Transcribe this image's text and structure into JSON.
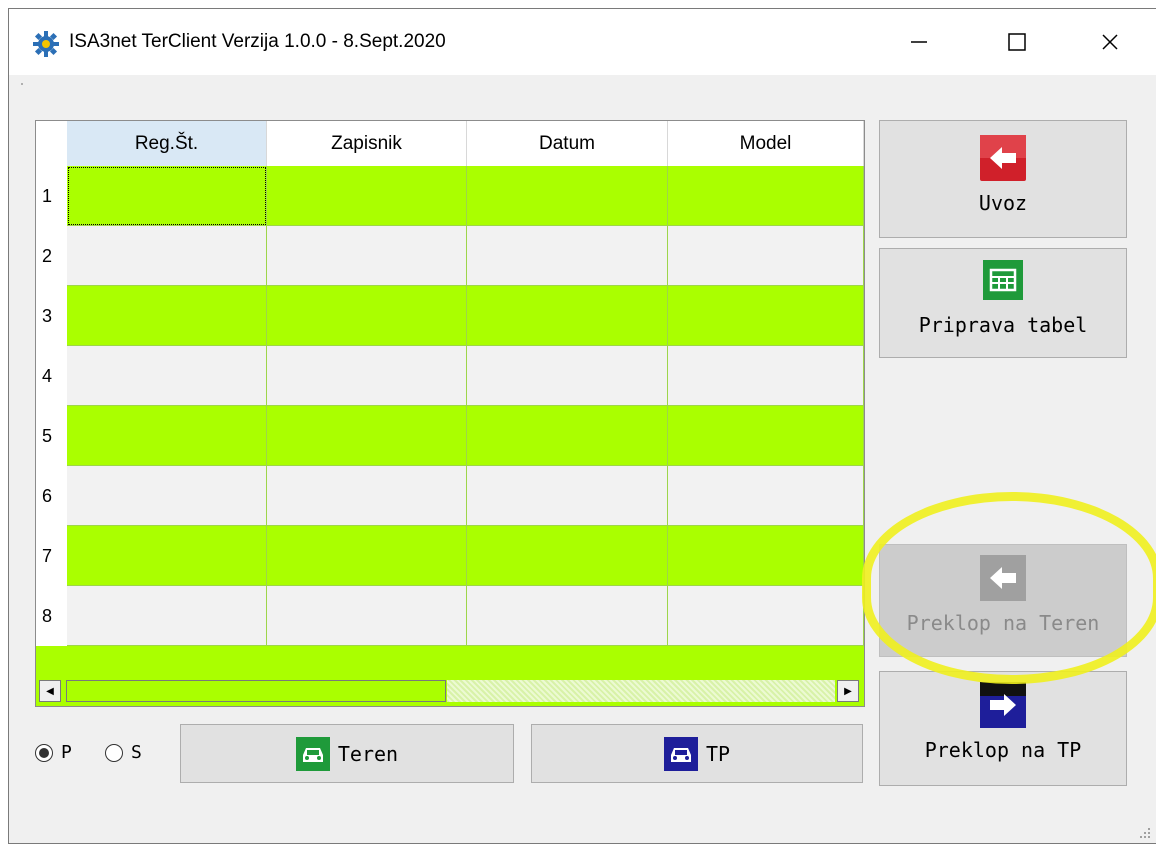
{
  "window": {
    "title": "ISA3net TerClient Verzija 1.0.0 - 8.Sept.2020",
    "icon": "gear-icon",
    "controls": [
      "minimize",
      "maximize",
      "close"
    ]
  },
  "grid": {
    "columns": [
      "Reg.Št.",
      "Zapisnik",
      "Datum",
      "Model"
    ],
    "selected_column": "Reg.Št.",
    "rows": [
      {
        "num": "1",
        "color": "green"
      },
      {
        "num": "2",
        "color": "gray"
      },
      {
        "num": "3",
        "color": "green"
      },
      {
        "num": "4",
        "color": "gray"
      },
      {
        "num": "5",
        "color": "green"
      },
      {
        "num": "6",
        "color": "gray"
      },
      {
        "num": "7",
        "color": "green"
      },
      {
        "num": "8",
        "color": "gray"
      }
    ],
    "row_colors": {
      "green": "#aaff00",
      "gray": "#f2f2f2"
    }
  },
  "side_buttons": {
    "uvoz": {
      "label": "Uvoz",
      "icon": "arrow-left-icon",
      "color": "#d0202a"
    },
    "priprava": {
      "label": "Priprava tabel",
      "icon": "table-icon",
      "color": "#1f9a3a"
    },
    "preklop_teren": {
      "label": "Preklop na Teren",
      "icon": "arrow-left-icon",
      "color": "#a0a0a0",
      "disabled": true
    },
    "preklop_tp": {
      "label": "Preklop na TP",
      "icon": "arrow-right-icon",
      "color": "#1e1e9a"
    }
  },
  "bottom": {
    "radio_p": {
      "label": "P",
      "checked": true
    },
    "radio_s": {
      "label": "S",
      "checked": false
    },
    "teren_button": {
      "label": "Teren",
      "icon": "car-icon",
      "color": "#1f9a3a"
    },
    "tp_button": {
      "label": "TP",
      "icon": "car-icon",
      "color": "#1e1e9a"
    }
  }
}
